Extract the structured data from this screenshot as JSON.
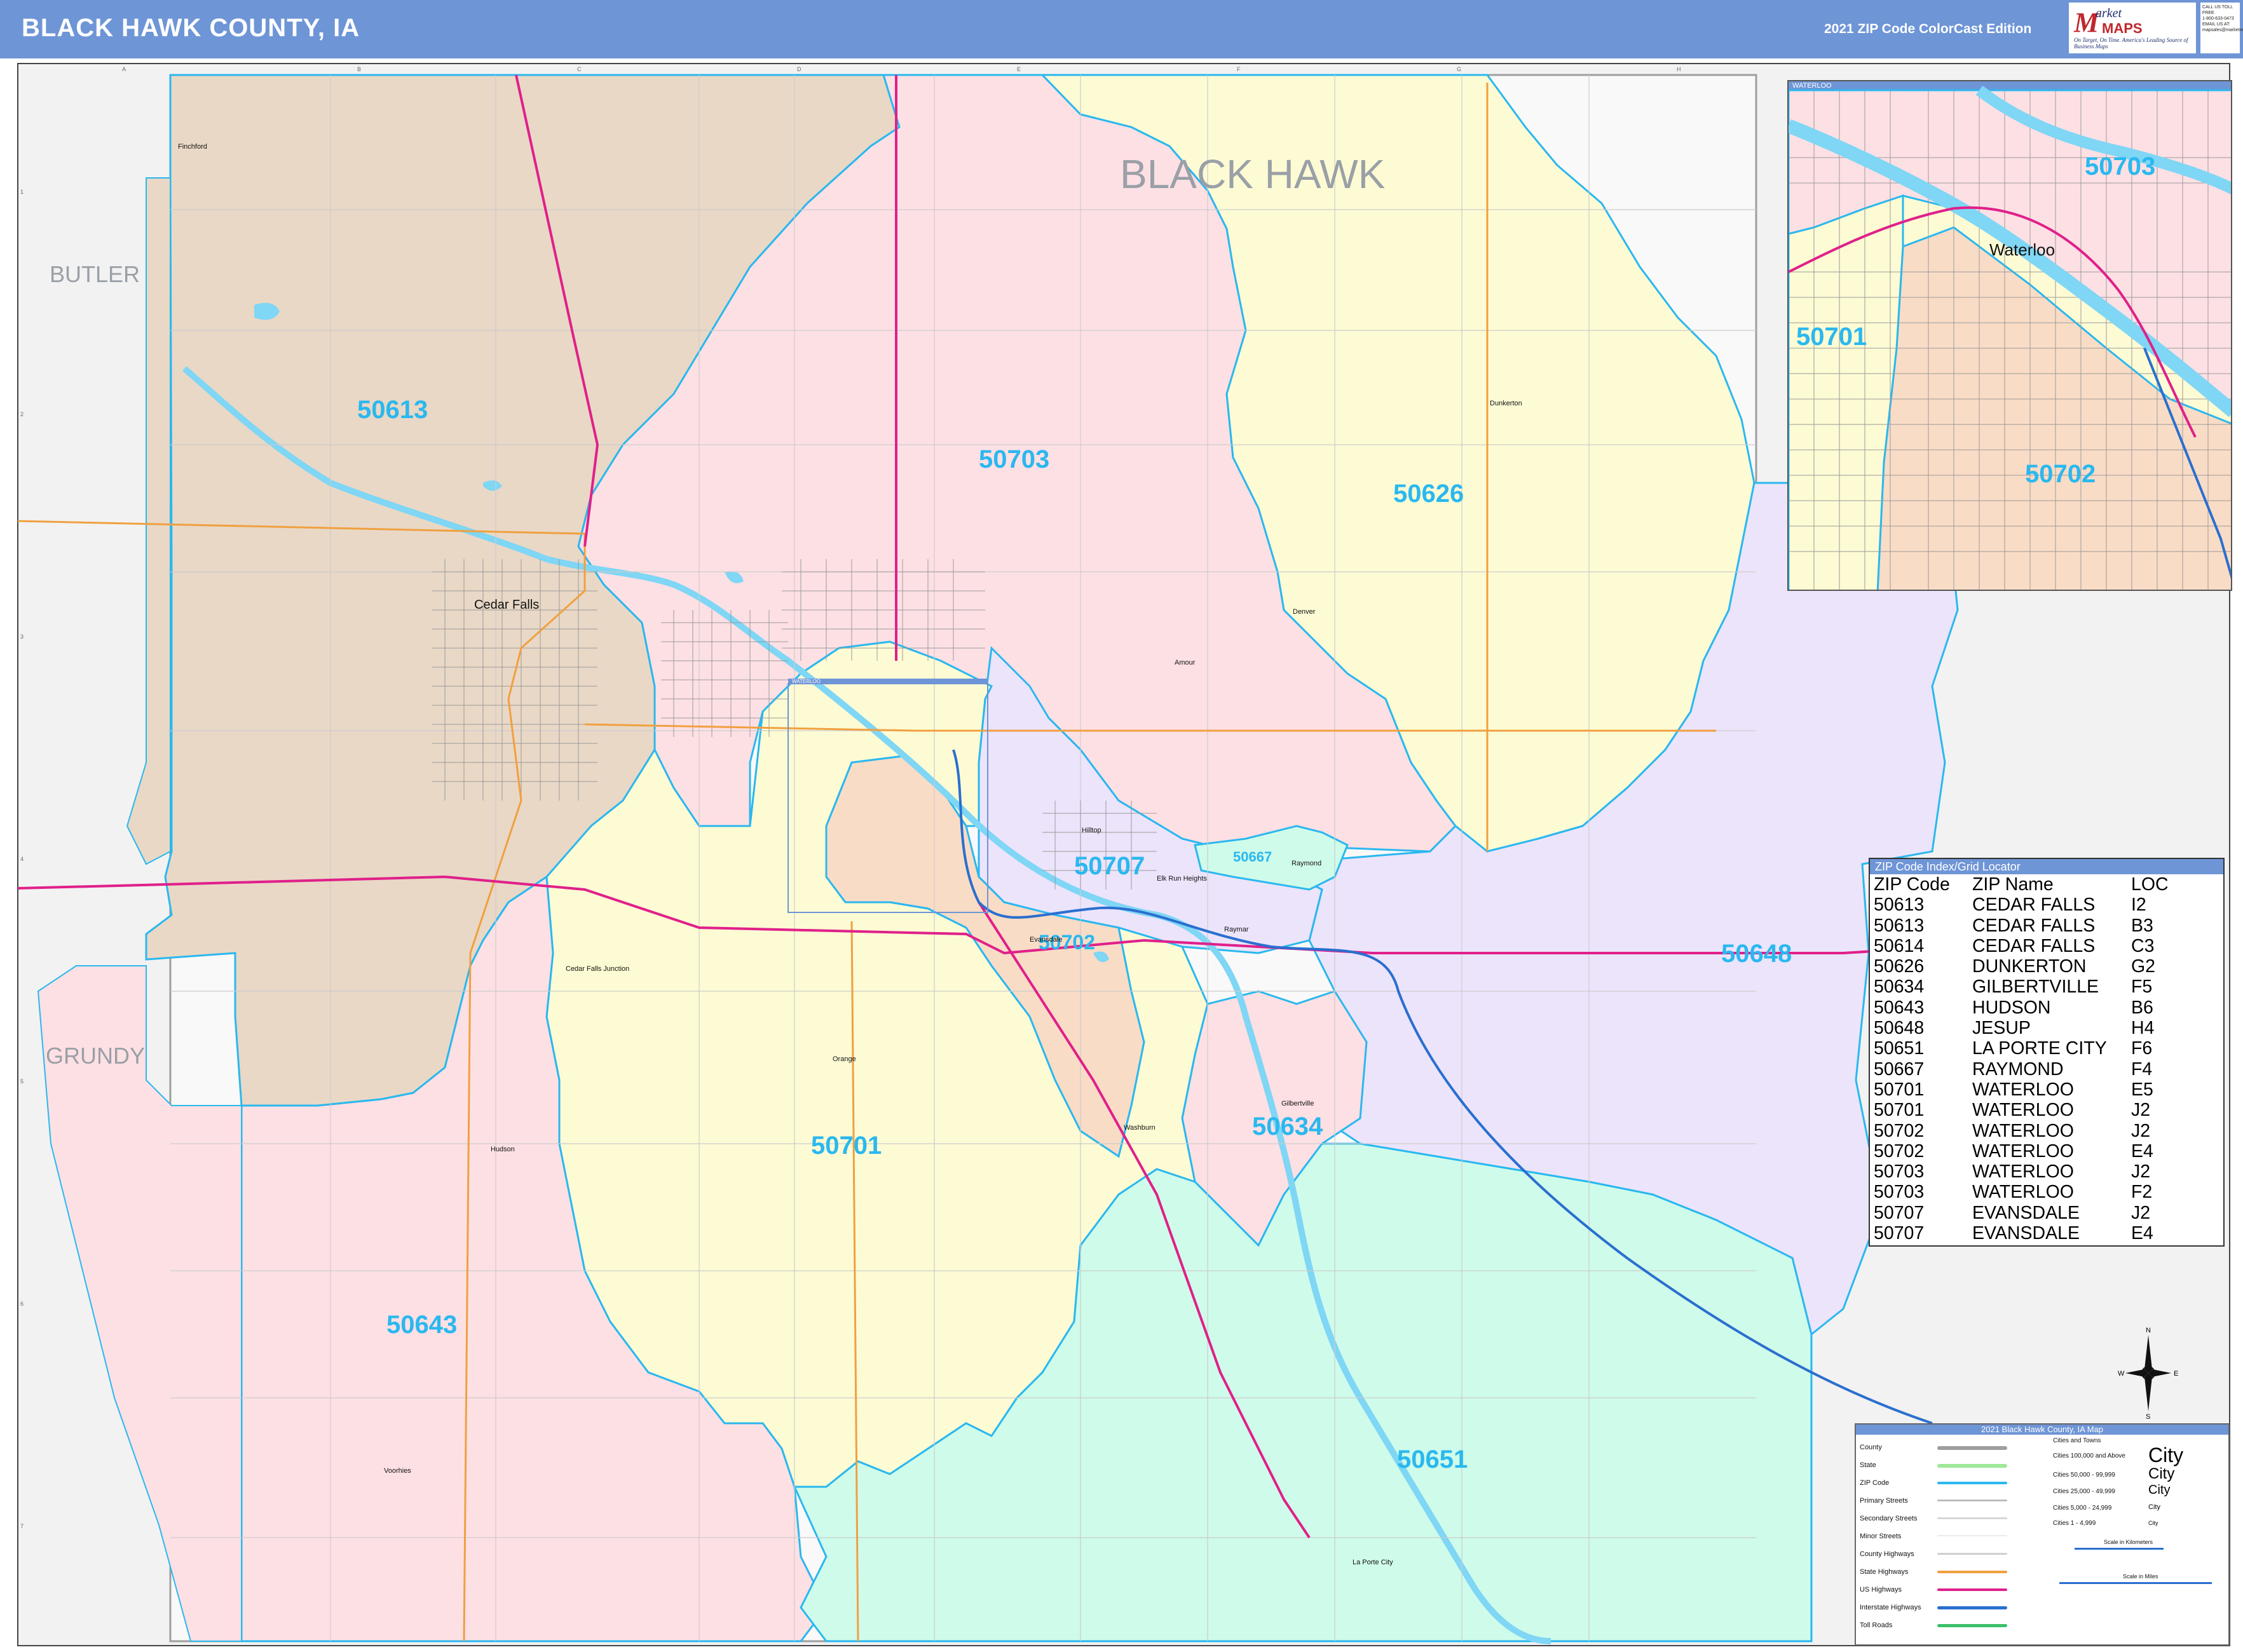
{
  "header": {
    "title": "BLACK HAWK COUNTY, IA",
    "edition": "2021 ZIP Code ColorCast Edition",
    "logo_main": "M",
    "logo_market": "arket",
    "logo_maps": "MAPS",
    "logo_tagline": "On Target, On Time. America's Leading Source of Business Maps",
    "contact_lines": [
      "CALL US TOLL FREE",
      "1-800-633-0473",
      "EMAIL US AT:",
      "mapsales@marketmaps.com"
    ]
  },
  "grid": {
    "columns": [
      "A",
      "B",
      "C",
      "D",
      "E",
      "F",
      "G",
      "H"
    ],
    "rows": [
      "1",
      "2",
      "3",
      "4",
      "5",
      "6",
      "7"
    ]
  },
  "counties": {
    "main": "BLACK HAWK",
    "butler": "BUTLER",
    "grundy": "GRUNDY"
  },
  "zip_labels": {
    "z50613": "50613",
    "z50703": "50703",
    "z50626": "50626",
    "z50707": "50707",
    "z50667": "50667",
    "z50702": "50702",
    "z50648": "50648",
    "z50701": "50701",
    "z50634": "50634",
    "z50643": "50643",
    "z50651": "50651"
  },
  "cities": {
    "cedar_falls": "Cedar Falls",
    "dunkerton": "Dunkerton",
    "denver": "Denver",
    "amour": "Amour",
    "hilltop": "Hilltop",
    "raymond": "Raymond",
    "elk_run_heights": "Elk Run Heights",
    "evansdale": "Evansdale",
    "cedar_falls_junction": "Cedar Falls Junction",
    "orange": "Orange",
    "gilbertville": "Gilbertville",
    "washburn": "Washburn",
    "hudson": "Hudson",
    "voorhies": "Voorhies",
    "la_porte_city": "La Porte City",
    "finchford": "Finchford",
    "raymar": "Raymar"
  },
  "inset": {
    "title": "WATERLOO",
    "city": "Waterloo",
    "z50703": "50703",
    "z50701": "50701",
    "z50702": "50702"
  },
  "inset_marker_label": "WATERLOO",
  "index": {
    "title": "ZIP Code Index/Grid Locator",
    "headers": [
      "ZIP Code",
      "ZIP Name",
      "LOC"
    ],
    "rows": [
      [
        "50613",
        "CEDAR FALLS",
        "I2"
      ],
      [
        "50613",
        "CEDAR FALLS",
        "B3"
      ],
      [
        "50614",
        "CEDAR FALLS",
        "C3"
      ],
      [
        "50626",
        "DUNKERTON",
        "G2"
      ],
      [
        "50634",
        "GILBERTVILLE",
        "F5"
      ],
      [
        "50643",
        "HUDSON",
        "B6"
      ],
      [
        "50648",
        "JESUP",
        "H4"
      ],
      [
        "50651",
        "LA PORTE CITY",
        "F6"
      ],
      [
        "50667",
        "RAYMOND",
        "F4"
      ],
      [
        "50701",
        "WATERLOO",
        "E5"
      ],
      [
        "50701",
        "WATERLOO",
        "J2"
      ],
      [
        "50702",
        "WATERLOO",
        "J2"
      ],
      [
        "50702",
        "WATERLOO",
        "E4"
      ],
      [
        "50703",
        "WATERLOO",
        "J2"
      ],
      [
        "50703",
        "WATERLOO",
        "F2"
      ],
      [
        "50707",
        "EVANSDALE",
        "J2"
      ],
      [
        "50707",
        "EVANSDALE",
        "E4"
      ]
    ]
  },
  "legend": {
    "title": "2021 Black Hawk County, IA Map",
    "items": [
      {
        "label": "County",
        "color": "#9e9e9e"
      },
      {
        "label": "State",
        "color": "#9ee89a"
      },
      {
        "label": "ZIP Code",
        "color": "#2ab8ef"
      },
      {
        "label": "Primary Streets",
        "color": "#bdbdbd"
      },
      {
        "label": "Secondary Streets",
        "color": "#d6d6d6"
      },
      {
        "label": "Minor Streets",
        "color": "#ebebeb"
      },
      {
        "label": "County Highways",
        "color": "#cfcfcf"
      },
      {
        "label": "State Highways",
        "color": "#f0a040"
      },
      {
        "label": "US Highways",
        "color": "#e0208a"
      },
      {
        "label": "Interstate Highways",
        "color": "#2a6fcf"
      },
      {
        "label": "Toll Roads",
        "color": "#3cc06a"
      }
    ],
    "cities_heading": "Cities and Towns",
    "city_classes": [
      {
        "label": "Cities 100,000 and Above",
        "sample": "City"
      },
      {
        "label": "Cities 50,000 - 99,999",
        "sample": "City"
      },
      {
        "label": "Cities 25,000 - 49,999",
        "sample": "City"
      },
      {
        "label": "Cities 5,000 - 24,999",
        "sample": "City"
      },
      {
        "label": "Cities 1 - 4,999",
        "sample": "City"
      }
    ],
    "scale_km": "Scale in Kilometers",
    "scale_mi": "Scale in Miles"
  },
  "compass": {
    "n": "N",
    "s": "S",
    "e": "E",
    "w": "W"
  },
  "colors": {
    "header": "#6e95d6",
    "zip_text": "#2ab8ef",
    "zip_border": "#2ab8ef",
    "z50613": "#e9d8c6",
    "z50703": "#fde0e4",
    "z50626": "#fdfbd4",
    "z50701": "#fdfbd4",
    "z50643": "#fde0e4",
    "z50648": "#ece4fb",
    "z50651": "#cffbea",
    "z50702": "#f9dcc6",
    "z50707": "#ece4fb",
    "outside": "#f2f2f2"
  }
}
